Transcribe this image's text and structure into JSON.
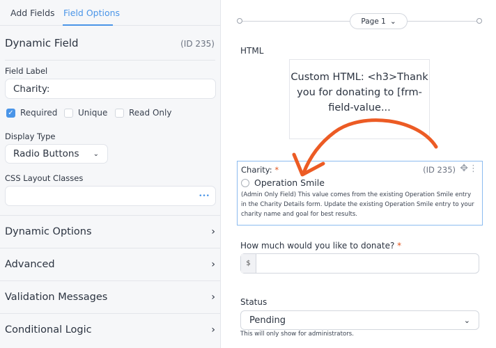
{
  "sidebar": {
    "tabs": [
      {
        "label": "Add Fields"
      },
      {
        "label": "Field Options"
      }
    ],
    "section_title": "Dynamic Field",
    "section_id": "(ID 235)",
    "field_label_label": "Field Label",
    "field_label_value": "Charity:",
    "checkboxes": [
      {
        "label": "Required",
        "checked": true
      },
      {
        "label": "Unique",
        "checked": false
      },
      {
        "label": "Read Only",
        "checked": false
      }
    ],
    "display_type_label": "Display Type",
    "display_type_value": "Radio Buttons",
    "css_label": "CSS Layout Classes",
    "css_value": "",
    "css_more": "•••",
    "accordions": [
      {
        "label": "Dynamic Options"
      },
      {
        "label": "Advanced"
      },
      {
        "label": "Validation Messages"
      },
      {
        "label": "Conditional Logic"
      }
    ]
  },
  "canvas": {
    "page_label": "Page 1",
    "html_label": "HTML",
    "html_preview": "Custom HTML: <h3>Thank you for donating to [frm-field-value...",
    "charity": {
      "label": "Charity:",
      "required": "*",
      "id": "(ID 235)",
      "option": "Operation Smile",
      "description": "(Admin Only Field) This value comes from the existing Operation Smile entry in the Charity Details form. Update the existing Operation Smile entry to your charity name and goal for best results."
    },
    "donate": {
      "label": "How much would you like to donate?",
      "required": "*",
      "prefix": "$",
      "value": ""
    },
    "status": {
      "label": "Status",
      "value": "Pending",
      "help": "This will only show for administrators."
    }
  },
  "colors": {
    "accent": "#4a95e8",
    "arrow": "#ec5b24"
  }
}
